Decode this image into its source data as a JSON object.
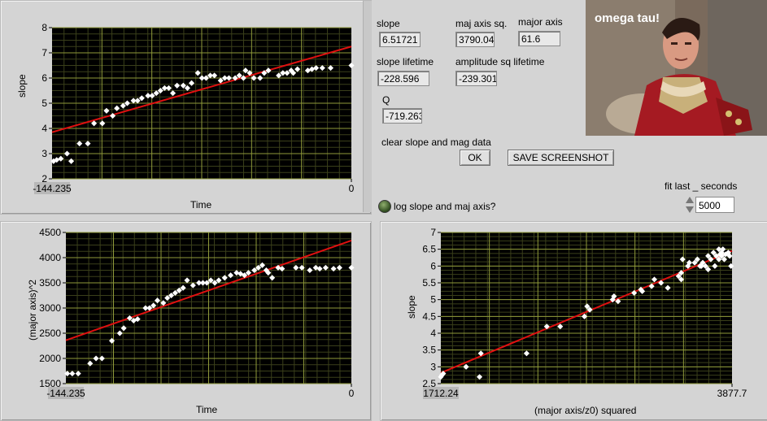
{
  "colors": {
    "plot_bg": "#000000",
    "grid": "#8f9a3a",
    "fit_line": "#e01010",
    "points": "#ffffff",
    "panel": "#d4d4d4"
  },
  "indicators": {
    "slope": {
      "label": "slope",
      "value": "6.51721"
    },
    "maj_axis_sq": {
      "label": "maj axis sq.",
      "value": "3790.04"
    },
    "major_axis": {
      "label": "major axis",
      "value": "61.6"
    },
    "slope_lifetime": {
      "label": "slope lifetime",
      "value": "-228.596"
    },
    "amplitude_sq_lifetime": {
      "label": "amplitude sq lifetime",
      "value": "-239.301"
    },
    "q": {
      "label": "Q",
      "value": "-719.263"
    }
  },
  "controls": {
    "clear_label": "clear slope and mag data",
    "ok_button": "OK",
    "screenshot_button": "SAVE SCREENSHOT",
    "log_label": "log slope and maj axis?",
    "fit_label": "fit last _ seconds",
    "fit_value": "5000"
  },
  "picture": {
    "caption": "omega tau!"
  },
  "chart_data": [
    {
      "id": "slope_vs_time",
      "type": "scatter",
      "xlabel": "Time",
      "ylabel": "slope",
      "xlim": [
        -144.235,
        0
      ],
      "ylim": [
        2,
        8
      ],
      "x_tick_labels": [
        "-144.235",
        "0"
      ],
      "y_ticks": [
        2,
        3,
        4,
        5,
        6,
        7,
        8
      ],
      "fit": {
        "x": [
          -144.235,
          0
        ],
        "y": [
          3.85,
          7.25
        ]
      },
      "points": {
        "x": [
          -143.5,
          -142,
          -140,
          -137,
          -135,
          -131,
          -127,
          -124,
          -120,
          -118,
          -115,
          -113,
          -110,
          -108,
          -105,
          -103,
          -101,
          -98,
          -96,
          -94,
          -92,
          -90,
          -88,
          -86,
          -84,
          -81,
          -79,
          -77,
          -74,
          -72,
          -70,
          -68,
          -66,
          -63,
          -61,
          -59,
          -56,
          -54,
          -52,
          -51,
          -49,
          -47,
          -44,
          -42,
          -40,
          -35,
          -33,
          -31,
          -29,
          -28,
          -26,
          -21,
          -19,
          -17,
          -14,
          -10,
          0
        ],
        "y": [
          2.7,
          2.75,
          2.8,
          3.0,
          2.7,
          3.4,
          3.4,
          4.2,
          4.2,
          4.7,
          4.5,
          4.8,
          4.9,
          5.0,
          5.1,
          5.1,
          5.2,
          5.3,
          5.3,
          5.4,
          5.5,
          5.6,
          5.6,
          5.4,
          5.7,
          5.7,
          5.6,
          5.8,
          6.2,
          6.0,
          6.0,
          6.1,
          6.1,
          5.9,
          6.0,
          6.0,
          6.0,
          6.1,
          6.0,
          6.3,
          6.2,
          6.0,
          6.0,
          6.2,
          6.3,
          6.1,
          6.2,
          6.2,
          6.3,
          6.2,
          6.35,
          6.3,
          6.35,
          6.4,
          6.4,
          6.4,
          6.5
        ]
      }
    },
    {
      "id": "majaxis_vs_time",
      "type": "scatter",
      "xlabel": "Time",
      "ylabel": "(major axis)^2",
      "xlim": [
        -144.235,
        0
      ],
      "ylim": [
        1500,
        4500
      ],
      "x_tick_labels": [
        "-144.235",
        "0"
      ],
      "y_ticks": [
        1500,
        2000,
        2500,
        3000,
        3500,
        4000,
        4500
      ],
      "fit": {
        "x": [
          -144.235,
          0
        ],
        "y": [
          2360,
          4340
        ]
      },
      "points": {
        "x": [
          -143.5,
          -141,
          -138,
          -132,
          -129,
          -126,
          -121,
          -117,
          -115,
          -112,
          -110,
          -108,
          -104,
          -102,
          -100,
          -98,
          -95,
          -93,
          -91,
          -89,
          -87,
          -85,
          -83,
          -80,
          -77,
          -75,
          -73,
          -71,
          -69,
          -67,
          -64,
          -61,
          -58,
          -56,
          -54,
          -52,
          -49,
          -47,
          -45,
          -43,
          -42,
          -40,
          -37,
          -35,
          -28,
          -25,
          -21,
          -18,
          -16,
          -13,
          -9,
          -6,
          0
        ],
        "y": [
          1700,
          1700,
          1700,
          1900,
          2000,
          2000,
          2350,
          2500,
          2600,
          2800,
          2750,
          2780,
          3000,
          3000,
          3050,
          3150,
          3100,
          3200,
          3250,
          3300,
          3350,
          3400,
          3550,
          3450,
          3500,
          3500,
          3500,
          3550,
          3500,
          3550,
          3600,
          3650,
          3700,
          3680,
          3650,
          3700,
          3750,
          3800,
          3850,
          3750,
          3700,
          3600,
          3800,
          3780,
          3800,
          3800,
          3750,
          3800,
          3780,
          3800,
          3780,
          3800,
          3800
        ]
      }
    },
    {
      "id": "slope_vs_majaxis",
      "type": "scatter",
      "xlabel": "(major axis/z0) squared",
      "ylabel": "slope",
      "xlim": [
        1712.24,
        3877.7
      ],
      "ylim": [
        2.5,
        7
      ],
      "x_tick_labels": [
        "1712.24",
        "3877.7"
      ],
      "y_ticks": [
        2.5,
        3,
        3.5,
        4,
        4.5,
        5,
        5.5,
        6,
        6.5,
        7
      ],
      "fit": {
        "x": [
          1712.24,
          3877.7
        ],
        "y": [
          2.82,
          6.45
        ]
      },
      "points": {
        "x": [
          1712,
          1720,
          1730,
          1900,
          2000,
          2010,
          2350,
          2500,
          2600,
          2780,
          2800,
          2820,
          2990,
          3000,
          3030,
          3150,
          3200,
          3210,
          3280,
          3300,
          3350,
          3400,
          3480,
          3500,
          3500,
          3510,
          3550,
          3560,
          3600,
          3620,
          3640,
          3650,
          3660,
          3680,
          3700,
          3700,
          3720,
          3740,
          3750,
          3760,
          3780,
          3780,
          3790,
          3800,
          3800,
          3810,
          3820,
          3830,
          3850,
          3860,
          3870
        ],
        "y": [
          2.7,
          2.75,
          2.8,
          3.0,
          2.7,
          3.4,
          3.4,
          4.2,
          4.2,
          4.5,
          4.8,
          4.7,
          5.0,
          5.1,
          4.95,
          5.2,
          5.3,
          5.25,
          5.4,
          5.6,
          5.5,
          5.35,
          5.7,
          5.6,
          5.8,
          6.2,
          6.0,
          6.1,
          6.1,
          6.2,
          6.0,
          6.0,
          6.1,
          6.0,
          6.3,
          5.9,
          6.2,
          6.4,
          6.0,
          6.3,
          6.5,
          6.2,
          6.35,
          6.3,
          6.4,
          6.5,
          6.2,
          6.35,
          6.4,
          6.3,
          6.0
        ]
      }
    }
  ]
}
